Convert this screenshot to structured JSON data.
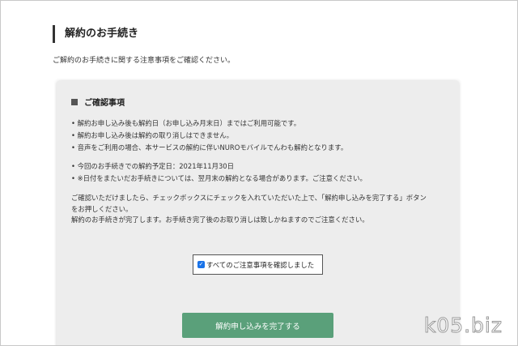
{
  "page": {
    "title": "解約のお手続き",
    "intro": "ご解約のお手続きに関する注意事項をご確認ください。"
  },
  "panel": {
    "title": "ご確認事項",
    "notes_a": [
      "解約お申し込み後も解約日（お申し込み月末日）まではご利用可能です。",
      "解約お申し込み後は解約の取り消しはできません。",
      "音声をご利用の場合、本サービスの解約に伴いNUROモバイルでんわも解約となります。"
    ],
    "notes_b": [
      "今回のお手続きでの解約予定日：2021年11月30日",
      "※日付をまたいだお手続きについては、翌月末の解約となる場合があります。ご注意ください。"
    ],
    "paragraph": [
      "ご確認いただけましたら、チェックボックスにチェックを入れていただいた上で、「解約申し込みを完了する」ボタン",
      "をお押しください。",
      "解約のお手続きが完了します。お手続き完了後のお取り消しは致しかねますのでご注意ください。"
    ],
    "checkbox_label": "すべてのご注意事項を確認しました",
    "checkbox_checked": true,
    "submit_label": "解約申し込みを完了する"
  },
  "watermark": "k05.biz",
  "colors": {
    "panel_bg": "#ededed",
    "button_bg": "#5aa07a",
    "checkbox": "#1a73e8"
  }
}
